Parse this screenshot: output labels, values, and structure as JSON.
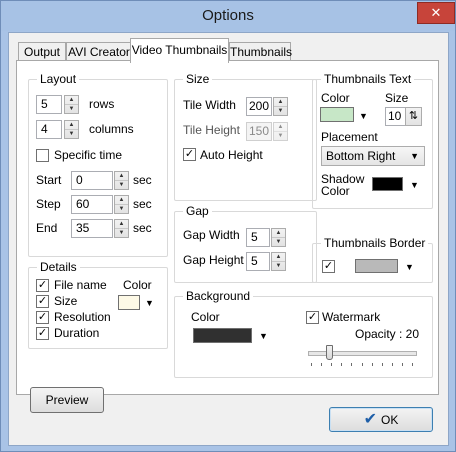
{
  "window": {
    "title": "Options",
    "close_glyph": "✕"
  },
  "tabs": [
    {
      "label": "Output"
    },
    {
      "label": "AVI Creator"
    },
    {
      "label": "Video Thumbnails"
    },
    {
      "label": "Thumbnails"
    }
  ],
  "layout": {
    "title": "Layout",
    "rows_value": "5",
    "rows_label": "rows",
    "columns_value": "4",
    "columns_label": "columns",
    "specific_time_label": "Specific time",
    "specific_time_checked": false,
    "start_label": "Start",
    "start_value": "0",
    "start_unit": "sec",
    "step_label": "Step",
    "step_value": "60",
    "step_unit": "sec",
    "end_label": "End",
    "end_value": "35",
    "end_unit": "sec"
  },
  "size": {
    "title": "Size",
    "tile_width_label": "Tile Width",
    "tile_width_value": "200",
    "tile_height_label": "Tile Height",
    "tile_height_value": "150",
    "auto_height_label": "Auto Height",
    "auto_height_checked": true
  },
  "gap": {
    "title": "Gap",
    "gap_width_label": "Gap Width",
    "gap_width_value": "5",
    "gap_height_label": "Gap Height",
    "gap_height_value": "5"
  },
  "thumb_text": {
    "title": "Thumbnails Text",
    "color_label": "Color",
    "color_value": "#c7e7c7",
    "size_label": "Size",
    "size_value": "10",
    "placement_label": "Placement",
    "placement_value": "Bottom Right",
    "shadow_label_1": "Shadow",
    "shadow_label_2": "Color",
    "shadow_color": "#000000"
  },
  "thumb_border": {
    "title": "Thumbnails Border",
    "checked": true,
    "color": "#b9b9b9"
  },
  "details": {
    "title": "Details",
    "file_name_label": "File name",
    "file_name_checked": true,
    "size_label": "Size",
    "size_checked": true,
    "resolution_label": "Resolution",
    "resolution_checked": true,
    "duration_label": "Duration",
    "duration_checked": true,
    "color_label": "Color",
    "color_value": "#fdf9e6"
  },
  "background": {
    "title": "Background",
    "color_label": "Color",
    "color_value": "#303030",
    "watermark_label": "Watermark",
    "watermark_checked": true,
    "opacity_label": "Opacity : 20",
    "opacity_fraction": 0.2
  },
  "buttons": {
    "preview_label": "Preview",
    "ok_label": "OK",
    "ok_icon": "✔"
  },
  "glyphs": {
    "check": "✓",
    "up": "▲",
    "down": "▼",
    "dropdown": "▼",
    "updown": "⇅"
  }
}
